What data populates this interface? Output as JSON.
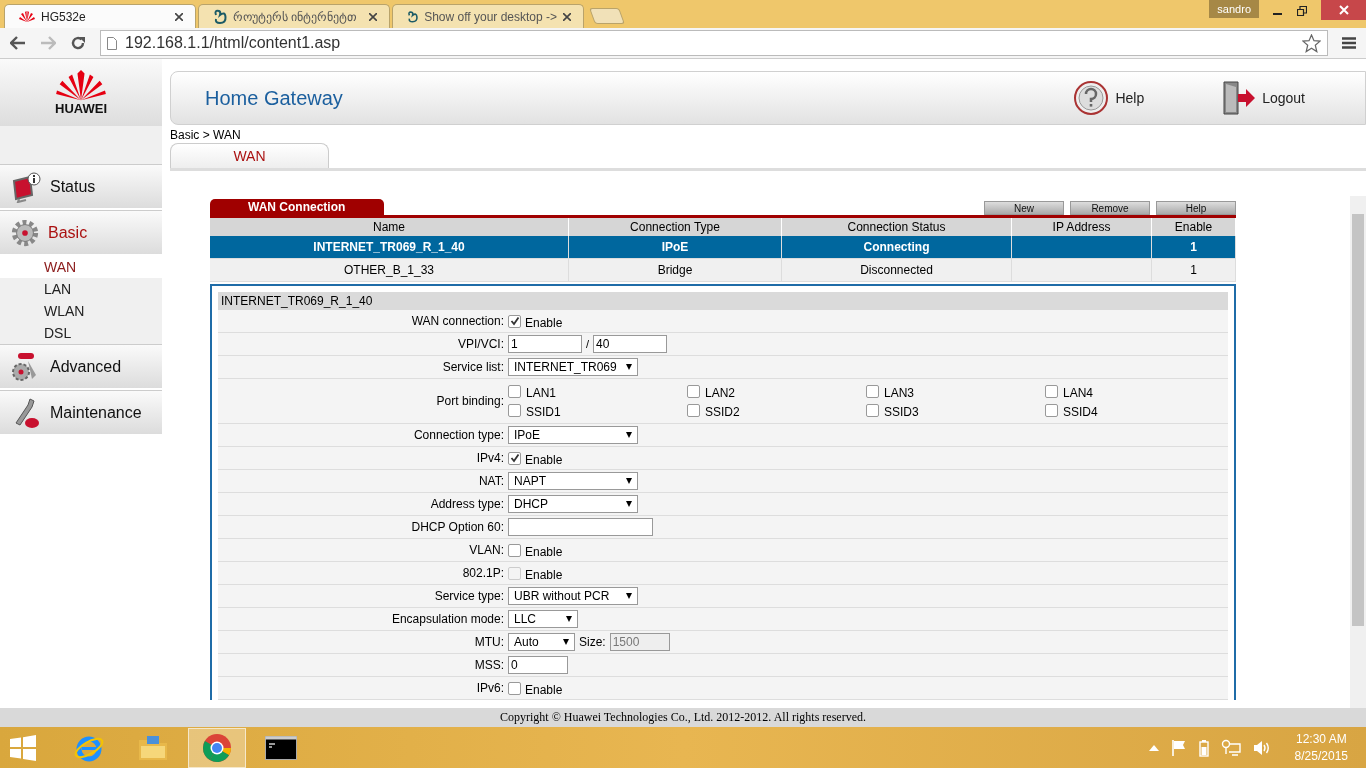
{
  "browser": {
    "tabs": [
      {
        "title": "HG532e",
        "selected": true
      },
      {
        "title": "როუტერს ინტერნეტთ",
        "selected": false
      },
      {
        "title": "Show off your desktop ->",
        "selected": false
      }
    ],
    "user": "sandro",
    "url": "192.168.1.1/html/content1.asp"
  },
  "header": {
    "logo_text": "HUAWEI",
    "title": "Home Gateway",
    "help": "Help",
    "logout": "Logout"
  },
  "sidebar": {
    "items": [
      {
        "label": "Status",
        "selected": false
      },
      {
        "label": "Basic",
        "selected": true,
        "children": [
          {
            "label": "WAN",
            "selected": true
          },
          {
            "label": "LAN",
            "selected": false
          },
          {
            "label": "WLAN",
            "selected": false
          },
          {
            "label": "DSL",
            "selected": false
          }
        ]
      },
      {
        "label": "Advanced",
        "selected": false
      },
      {
        "label": "Maintenance",
        "selected": false
      }
    ]
  },
  "breadcrumb": "Basic > WAN",
  "tabs": [
    {
      "label": "WAN",
      "selected": true
    }
  ],
  "wan": {
    "title": "WAN Connection",
    "buttons": [
      "New",
      "Remove",
      "Help"
    ],
    "columns": [
      "Name",
      "Connection Type",
      "Connection Status",
      "IP Address",
      "Enable"
    ],
    "rows": [
      {
        "cells": [
          "INTERNET_TR069_R_1_40",
          "IPoE",
          "Connecting",
          "",
          "1"
        ],
        "selected": true
      },
      {
        "cells": [
          "OTHER_B_1_33",
          "Bridge",
          "Disconnected",
          "",
          "1"
        ],
        "selected": false
      }
    ]
  },
  "form": {
    "title": "INTERNET_TR069_R_1_40",
    "rows": [
      {
        "kind": "checkbox",
        "label": "WAN connection:",
        "text": "Enable",
        "checked": true,
        "disabled": false
      },
      {
        "kind": "pair",
        "label": "VPI/VCI:",
        "value": "1",
        "separator": "/",
        "value2": "40"
      },
      {
        "kind": "select",
        "label": "Service list:",
        "value": "INTERNET_TR069"
      },
      {
        "kind": "ports",
        "label": "Port binding:",
        "ports": [
          {
            "name": "LAN1",
            "checked": false
          },
          {
            "name": "LAN2",
            "checked": false
          },
          {
            "name": "LAN3",
            "checked": false
          },
          {
            "name": "LAN4",
            "checked": false
          },
          {
            "name": "SSID1",
            "checked": false
          },
          {
            "name": "SSID2",
            "checked": false
          },
          {
            "name": "SSID3",
            "checked": false
          },
          {
            "name": "SSID4",
            "checked": false
          }
        ]
      },
      {
        "kind": "select",
        "label": "Connection type:",
        "value": "IPoE"
      },
      {
        "kind": "checkbox",
        "label": "IPv4:",
        "text": "Enable",
        "checked": true,
        "disabled": false
      },
      {
        "kind": "select",
        "label": "NAT:",
        "value": "NAPT"
      },
      {
        "kind": "select",
        "label": "Address type:",
        "value": "DHCP"
      },
      {
        "kind": "input",
        "label": "DHCP Option 60:"
      },
      {
        "kind": "checkbox",
        "label": "VLAN:",
        "text": "Enable",
        "checked": false,
        "disabled": false
      },
      {
        "kind": "checkbox",
        "label": "802.1P:",
        "text": "Enable",
        "checked": false,
        "disabled": true
      },
      {
        "kind": "select",
        "label": "Service type:",
        "value": "UBR without PCR"
      },
      {
        "kind": "smallselect",
        "label": "Encapsulation mode:",
        "value": "LLC"
      },
      {
        "kind": "mtu",
        "label": "MTU:",
        "value": "Auto",
        "size_label": "Size:",
        "size": "1500"
      },
      {
        "kind": "input",
        "label": "MSS:",
        "value": "0"
      },
      {
        "kind": "checkbox",
        "label": "IPv6:",
        "text": "Enable",
        "checked": false,
        "disabled": false
      }
    ]
  },
  "footer": "Copyright © Huawei Technologies Co., Ltd. 2012-2012. All rights reserved.",
  "taskbar": {
    "apps": [
      {
        "selected": false
      },
      {
        "selected": false
      },
      {
        "selected": true
      },
      {
        "selected": false
      }
    ],
    "time": "12:30 AM",
    "date": "8/25/2015"
  }
}
